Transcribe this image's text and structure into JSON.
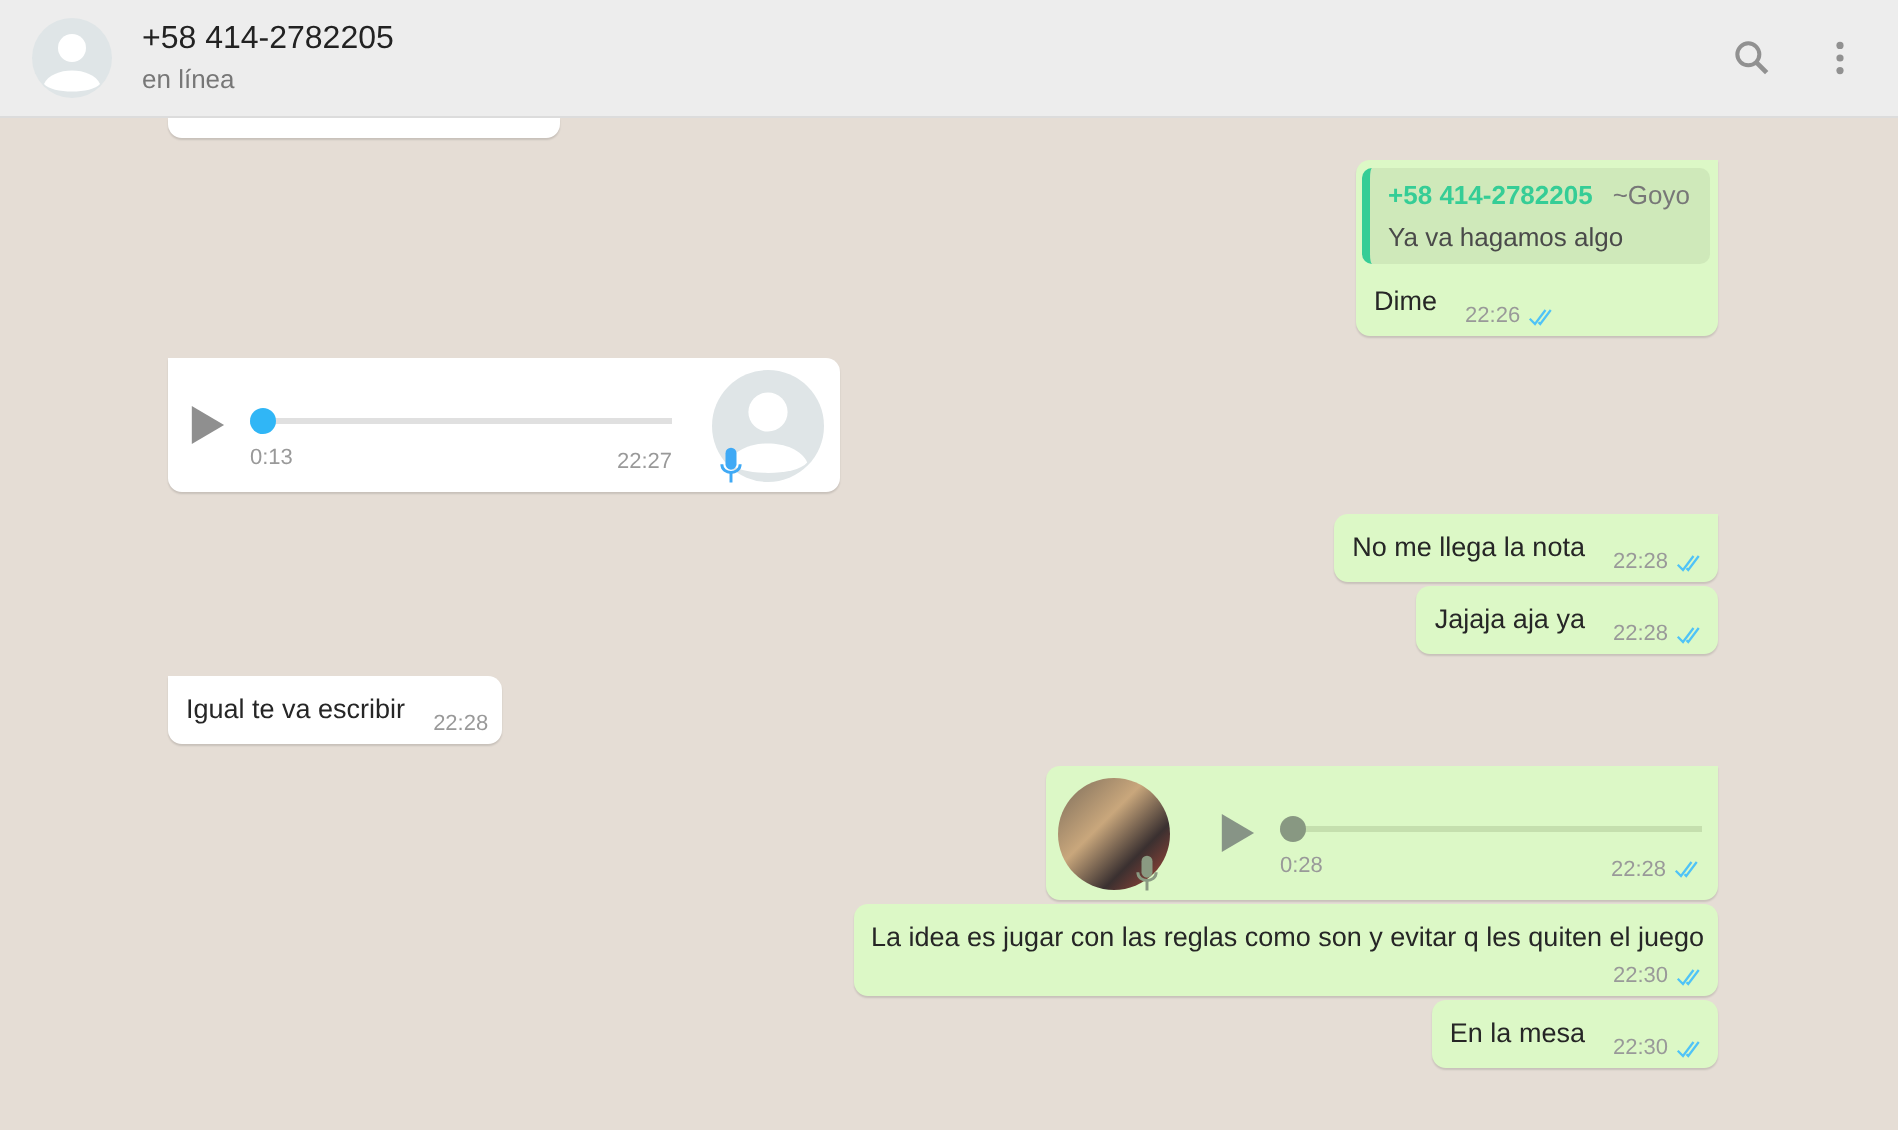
{
  "header": {
    "title": "+58 414-2782205",
    "status": "en línea"
  },
  "messages": [
    {
      "kind": "stub",
      "out": false
    },
    {
      "kind": "quoted",
      "out": true,
      "tail": true,
      "quote": {
        "author": "+58 414-2782205",
        "alias": "~Goyo",
        "text": "Ya va hagamos algo"
      },
      "text": "Dime",
      "time": "22:26",
      "read": true
    },
    {
      "kind": "audio",
      "out": false,
      "tail": true,
      "duration": "0:13",
      "time": "22:27",
      "level": 0
    },
    {
      "kind": "text",
      "out": true,
      "tail": true,
      "text": "No me llega la nota",
      "time": "22:28",
      "read": true
    },
    {
      "kind": "text",
      "out": true,
      "tail": false,
      "text": "Jajaja aja ya",
      "time": "22:28",
      "read": true
    },
    {
      "kind": "text",
      "out": false,
      "tail": true,
      "text": "Igual te va escribir",
      "time": "22:28"
    },
    {
      "kind": "audio",
      "out": true,
      "tail": true,
      "duration": "0:28",
      "time": "22:28",
      "read": true,
      "level": 0
    },
    {
      "kind": "text",
      "out": true,
      "tail": false,
      "wide": true,
      "text": "La idea es jugar con las reglas como son y evitar q les quiten el juego",
      "time": "22:30",
      "read": true
    },
    {
      "kind": "text",
      "out": true,
      "tail": false,
      "text": "En la mesa",
      "time": "22:30",
      "read": true
    }
  ]
}
